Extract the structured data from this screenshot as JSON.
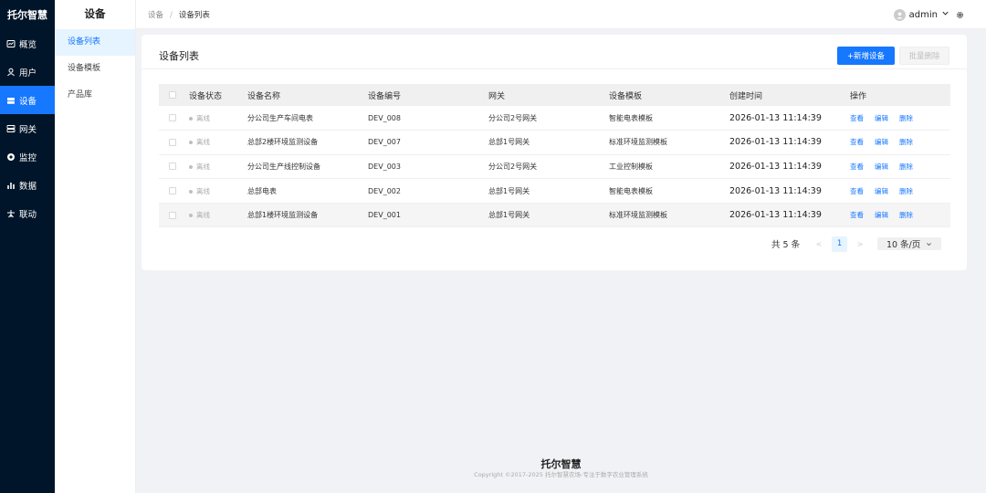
{
  "brand": "托尔智慧",
  "nav": [
    {
      "label": "概览",
      "icon": "dashboard-icon"
    },
    {
      "label": "用户",
      "icon": "user-icon"
    },
    {
      "label": "设备",
      "icon": "device-icon",
      "active": true
    },
    {
      "label": "网关",
      "icon": "gateway-icon"
    },
    {
      "label": "监控",
      "icon": "monitor-icon"
    },
    {
      "label": "数据",
      "icon": "chart-icon"
    },
    {
      "label": "联动",
      "icon": "linkage-icon"
    }
  ],
  "submenu": {
    "title": "设备",
    "items": [
      "设备列表",
      "设备模板",
      "产品库"
    ],
    "active_index": 0
  },
  "breadcrumb": [
    "设备",
    "设备列表"
  ],
  "user": {
    "name": "admin"
  },
  "card": {
    "title": "设备列表",
    "add_button": "+新增设备",
    "batch_delete_button": "批量删除"
  },
  "table": {
    "columns": [
      "设备状态",
      "设备名称",
      "设备编号",
      "网关",
      "设备模板",
      "创建时间",
      "操作"
    ],
    "rows": [
      {
        "status": "离线",
        "name": "分公司生产车间电表",
        "code": "DEV_008",
        "gateway": "分公司2号网关",
        "template": "智能电表模板",
        "created": "2026-01-13 11:14:39"
      },
      {
        "status": "离线",
        "name": "总部2楼环境监测设备",
        "code": "DEV_007",
        "gateway": "总部1号网关",
        "template": "标准环境监测模板",
        "created": "2026-01-13 11:14:39"
      },
      {
        "status": "离线",
        "name": "分公司生产线控制设备",
        "code": "DEV_003",
        "gateway": "分公司2号网关",
        "template": "工业控制模板",
        "created": "2026-01-13 11:14:39"
      },
      {
        "status": "离线",
        "name": "总部电表",
        "code": "DEV_002",
        "gateway": "总部1号网关",
        "template": "智能电表模板",
        "created": "2026-01-13 11:14:39"
      },
      {
        "status": "离线",
        "name": "总部1楼环境监测设备",
        "code": "DEV_001",
        "gateway": "总部1号网关",
        "template": "标准环境监测模板",
        "created": "2026-01-13 11:14:39"
      }
    ],
    "actions": [
      "查看",
      "编辑",
      "删除"
    ]
  },
  "pagination": {
    "total_text": "共 5 条",
    "prev": "<",
    "current": "1",
    "next": ">",
    "page_size": "10 条/页"
  },
  "footer": {
    "brand": "托尔智慧",
    "copyright": "Copyright ©2017-2025 托尔智慧农场-专注于数字农业管理系统"
  }
}
